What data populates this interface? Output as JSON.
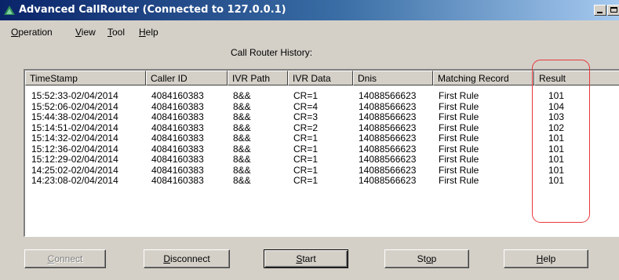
{
  "window": {
    "title": "Advanced CallRouter (Connected to 127.0.0.1)"
  },
  "menu": [
    {
      "mnemonic": "O",
      "rest": "peration"
    },
    {
      "mnemonic": "V",
      "rest": "iew"
    },
    {
      "mnemonic": "T",
      "rest": "ool"
    },
    {
      "mnemonic": "H",
      "rest": "elp"
    }
  ],
  "history_label": "Call Router History:",
  "table": {
    "columns": [
      "TimeStamp",
      "Caller ID",
      "IVR Path",
      "IVR Data",
      "Dnis",
      "Matching Record",
      "Result"
    ],
    "rows": [
      [
        "15:52:33-02/04/2014",
        "4084160383",
        "8&&",
        "CR=1",
        "14088566623",
        "First Rule",
        "101"
      ],
      [
        "15:52:06-02/04/2014",
        "4084160383",
        "8&&",
        "CR=4",
        "14088566623",
        "First Rule",
        "104"
      ],
      [
        "15:44:38-02/04/2014",
        "4084160383",
        "8&&",
        "CR=3",
        "14088566623",
        "First Rule",
        "103"
      ],
      [
        "15:14:51-02/04/2014",
        "4084160383",
        "8&&",
        "CR=2",
        "14088566623",
        "First Rule",
        "102"
      ],
      [
        "15:14:32-02/04/2014",
        "4084160383",
        "8&&",
        "CR=1",
        "14088566623",
        "First Rule",
        "101"
      ],
      [
        "15:12:36-02/04/2014",
        "4084160383",
        "8&&",
        "CR=1",
        "14088566623",
        "First Rule",
        "101"
      ],
      [
        "15:12:29-02/04/2014",
        "4084160383",
        "8&&",
        "CR=1",
        "14088566623",
        "First Rule",
        "101"
      ],
      [
        "14:25:02-02/04/2014",
        "4084160383",
        "8&&",
        "CR=1",
        "14088566623",
        "First Rule",
        "101"
      ],
      [
        "14:23:08-02/04/2014",
        "4084160383",
        "8&&",
        "CR=1",
        "14088566623",
        "First Rule",
        "101"
      ]
    ]
  },
  "buttons": {
    "connect": {
      "mnemonic": "C",
      "rest": "onnect",
      "enabled": false
    },
    "disconnect": {
      "mnemonic": "D",
      "rest": "isconnect",
      "enabled": true
    },
    "start": {
      "mnemonic": "S",
      "rest": "tart",
      "enabled": true
    },
    "stop": {
      "pre": "St",
      "mnemonic": "o",
      "rest": "p",
      "enabled": true
    },
    "help": {
      "mnemonic": "H",
      "rest": "elp",
      "enabled": true
    }
  },
  "colors": {
    "highlight": "#e8383d",
    "title_bar_start": "#0a246a",
    "title_bar_end": "#a6caf0",
    "face": "#d4d0c8"
  }
}
